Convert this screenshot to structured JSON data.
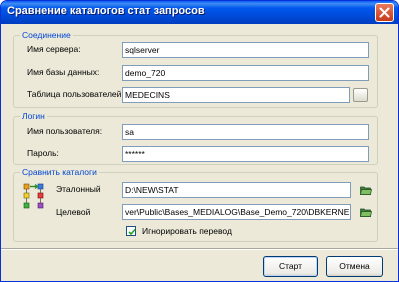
{
  "window": {
    "title": "Сравнение каталогов стат запросов"
  },
  "connection": {
    "legend": "Соединение",
    "server_label": "Имя сервера:",
    "server_value": "sqlserver",
    "db_label": "Имя базы данных:",
    "db_value": "demo_720",
    "users_table_label": "Таблица пользователей",
    "users_table_value": "MEDECINS"
  },
  "login": {
    "legend": "Логин",
    "user_label": "Имя пользователя:",
    "user_value": "sa",
    "password_label": "Пароль:",
    "password_value": "******"
  },
  "compare": {
    "legend": "Сравнить каталоги",
    "reference_label": "Эталонный",
    "reference_value": "D:\\NEW\\STAT",
    "target_label": "Целевой",
    "target_value": "ver\\Public\\Bases_MEDIALOG\\Base_Demo_720\\DBKERNEL\\STAT",
    "ignore_translation_label": "Игнорировать перевод",
    "ignore_translation_checked": true
  },
  "buttons": {
    "start": "Старт",
    "cancel": "Отмена"
  },
  "icons": {
    "close": "close-icon",
    "compare": "compare-folders-icon",
    "browse": "folder-open-icon"
  }
}
